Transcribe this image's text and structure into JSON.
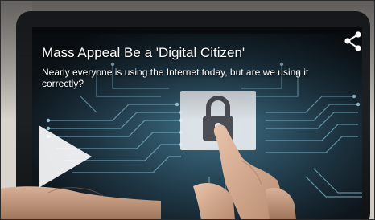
{
  "video": {
    "title": "Mass Appeal Be a 'Digital Citizen'",
    "description": "Nearly everyone is using the Internet today, but are we using it correctly?"
  },
  "controls": {
    "share_icon": "share-icon",
    "play_icon": "play-icon"
  },
  "colors": {
    "background": "#1a1d22",
    "circuit": "#7fb4c9",
    "text": "#ffffff"
  }
}
